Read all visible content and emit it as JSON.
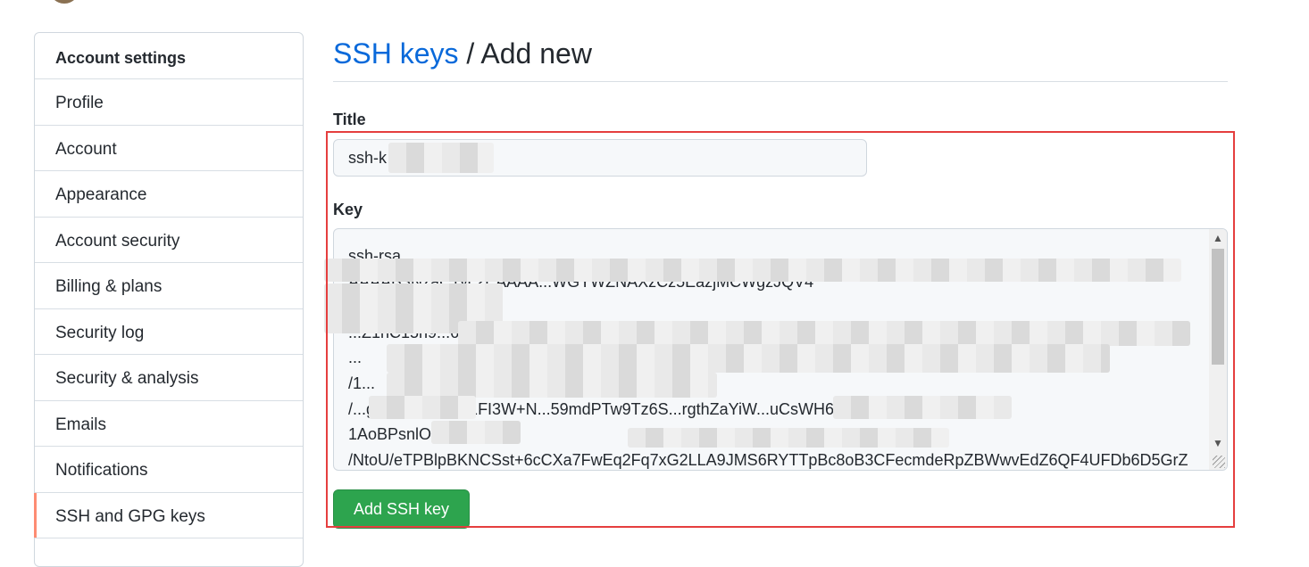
{
  "sidebar": {
    "heading": "Account settings",
    "items": [
      {
        "label": "Profile"
      },
      {
        "label": "Account"
      },
      {
        "label": "Appearance"
      },
      {
        "label": "Account security"
      },
      {
        "label": "Billing & plans"
      },
      {
        "label": "Security log"
      },
      {
        "label": "Security & analysis"
      },
      {
        "label": "Emails"
      },
      {
        "label": "Notifications"
      },
      {
        "label": "SSH and GPG keys",
        "selected": true
      }
    ]
  },
  "page": {
    "breadcrumb_link": "SSH keys",
    "separator": " / ",
    "title": "Add new"
  },
  "form": {
    "title_label": "Title",
    "title_value": "ssh-k",
    "key_label": "Key",
    "key_value": "ssh-rsa\nAAAAB3NzaC1yc2EAAAA...WGYWZNAXzCz5EazjMCWgzJQV4\neCWb5Vlt...\n...Z1nC15h9...6pxHibXP4GSqQ\n...\n/1...\n/...gtLpjrwLkGqQ1FI3W+N...59mdPTw9Tz6S...rgthZaYiW...uCsWH6GHxn2uRJXbr\n1AoBPsnlOR...\n/NtoU/eTPBlpBKNCSst+6cCXa7FwEq2Fq7xG2LLA9JMS6RYTTpBc8oB3CFecmdeRpZBWwvEdZ6QF4UFDb6D5GrZ",
    "submit_label": "Add SSH key"
  },
  "colors": {
    "link": "#0969da",
    "primary_button": "#2da44e",
    "selected_marker": "#fd8c73",
    "highlight": "#e53e3e"
  }
}
